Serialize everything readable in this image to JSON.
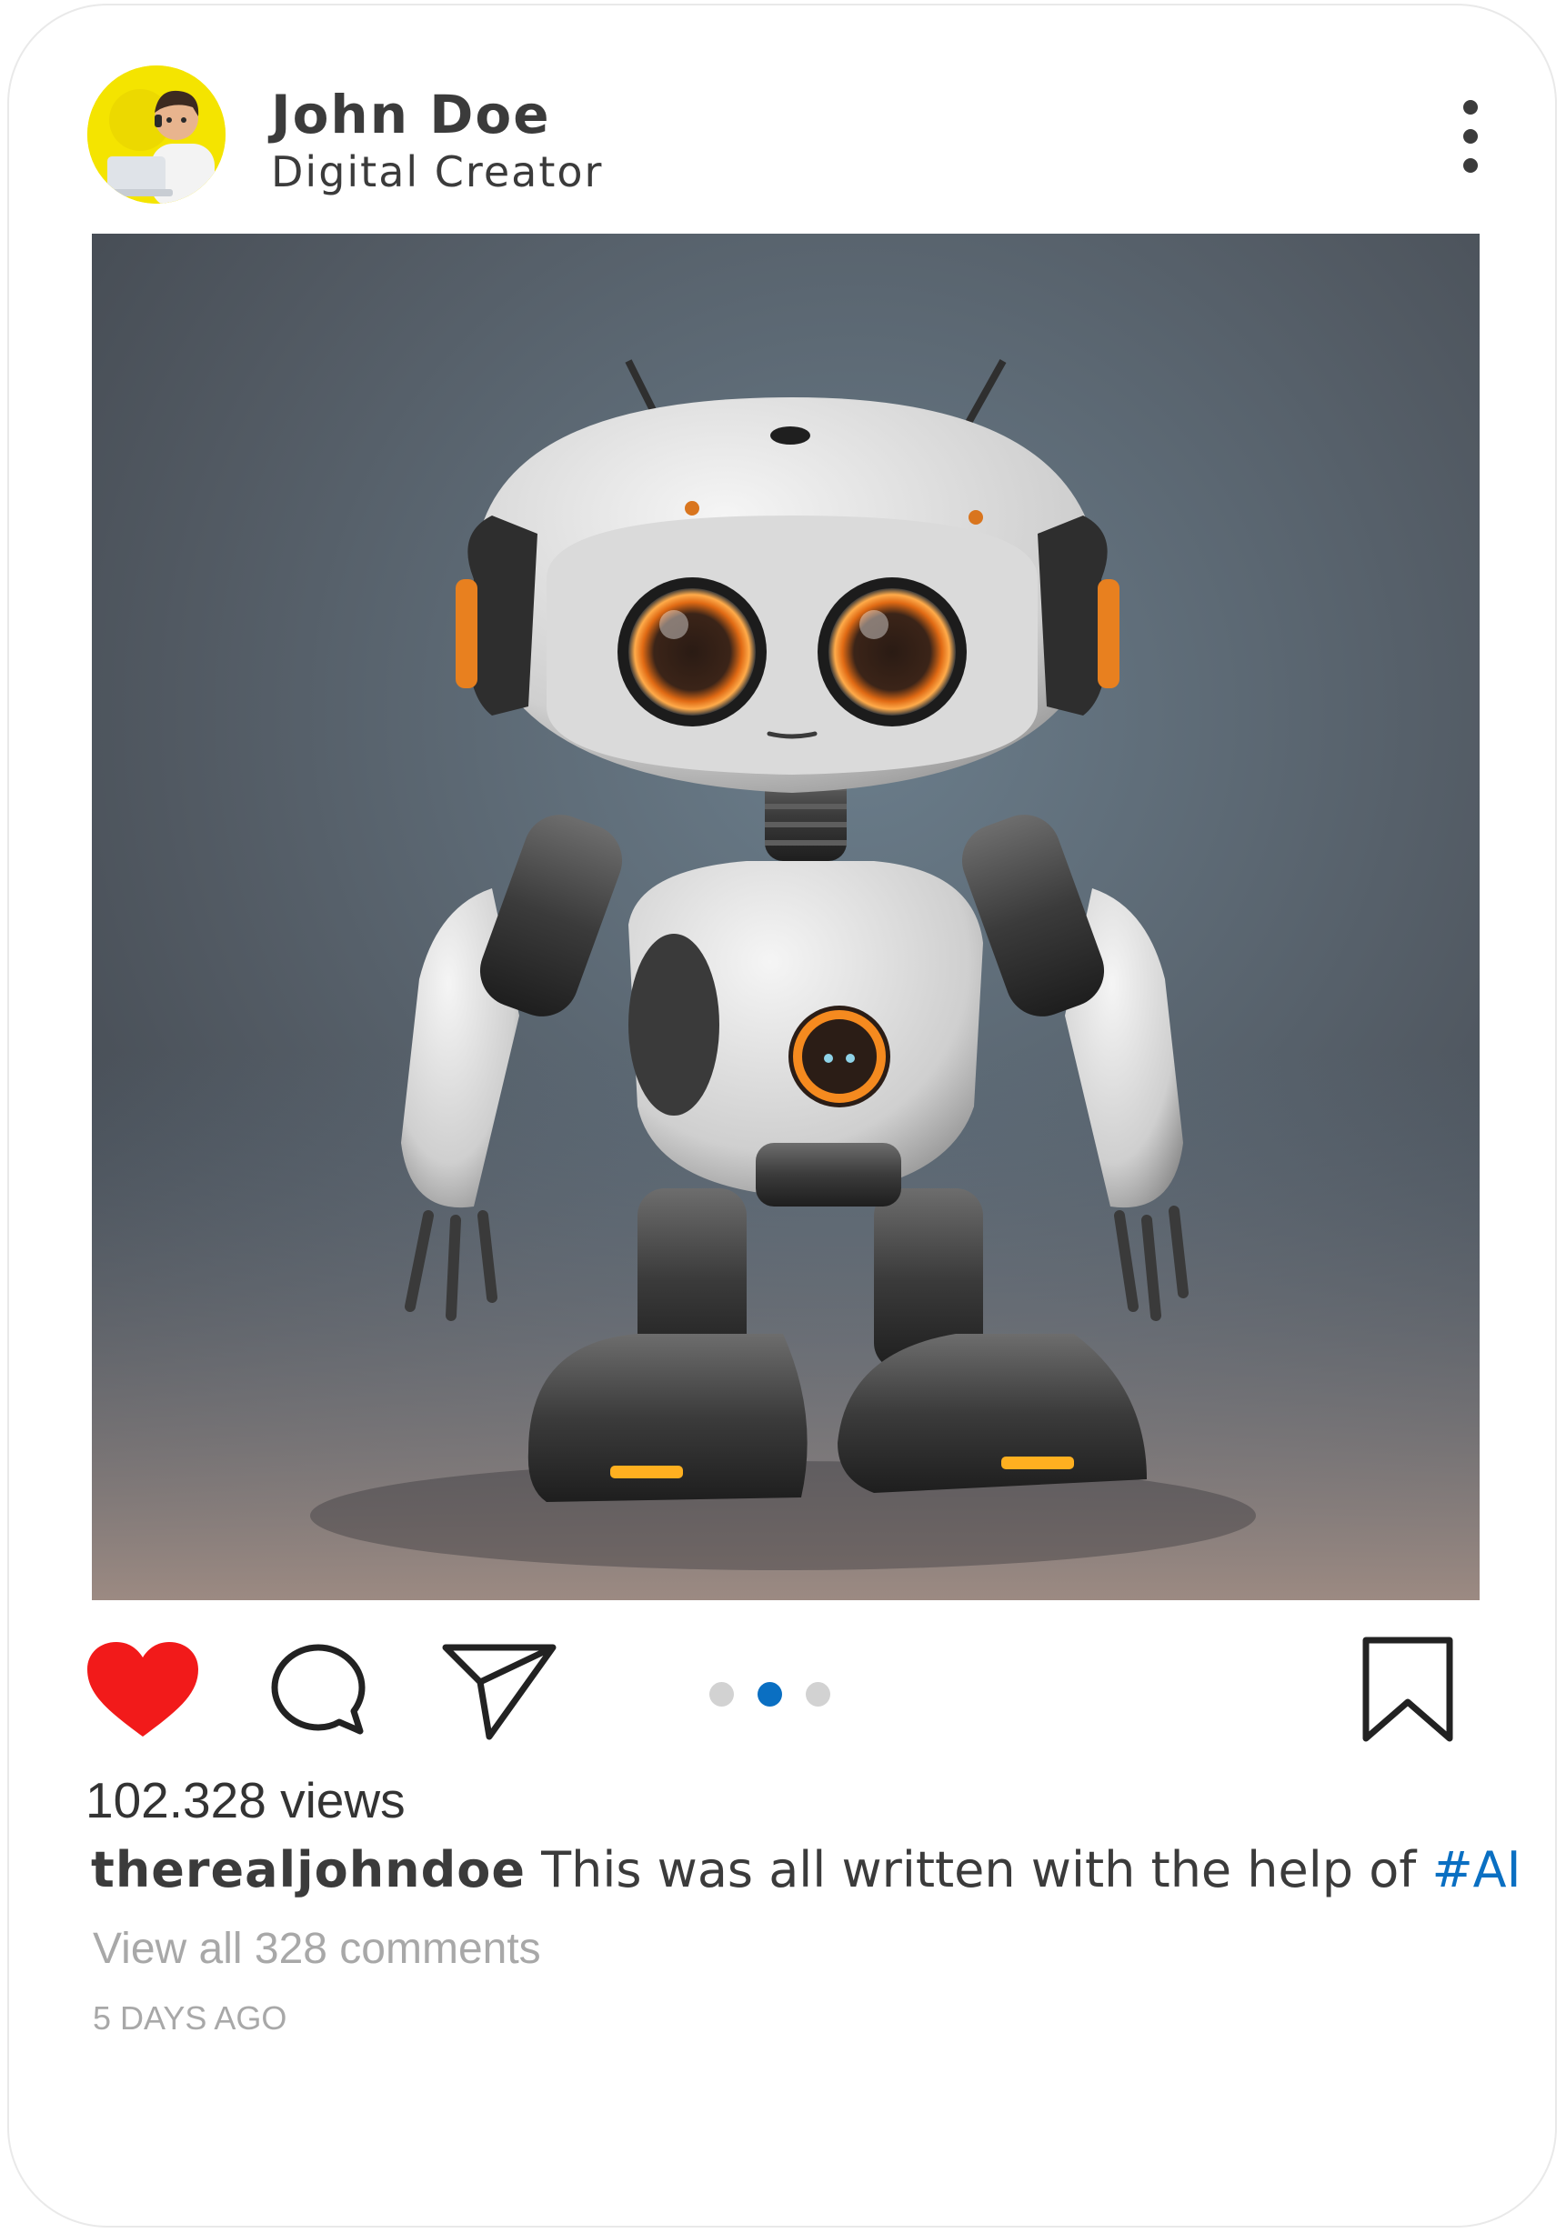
{
  "post": {
    "author_name": "John Doe",
    "author_subtitle": "Digital Creator",
    "views": "102.328 views",
    "caption_user": "therealjohndoe",
    "caption_text": "This was all written with the help of",
    "caption_hashtag": "#AI",
    "comments_link": "View all 328 comments",
    "timestamp": "5 DAYS AGO",
    "liked": true,
    "carousel_dot_count": 3,
    "carousel_active_index": 1
  },
  "icons": {
    "like": "heart-icon",
    "comment": "comment-bubble-icon",
    "share": "paper-plane-icon",
    "save": "bookmark-icon",
    "more": "more-vertical-icon"
  },
  "colors": {
    "like": "#f21a1a",
    "hashtag": "#0a6fc2",
    "active_dot": "#0a6fc2",
    "inactive_dot": "#d2d2d2",
    "muted_text": "#a8a8a8",
    "avatar_bg": "#f4e400"
  }
}
